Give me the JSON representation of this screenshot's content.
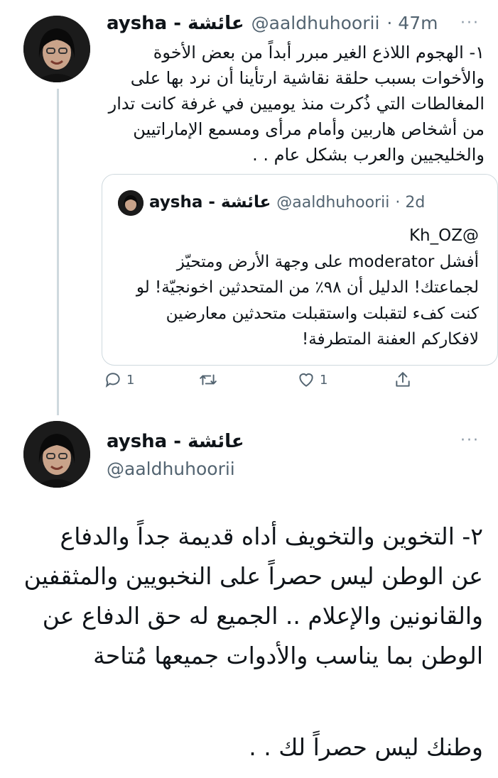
{
  "tweet1": {
    "display_name": "aysha - عائشة",
    "handle": "@aaldhuhoorii",
    "time": "· 47m",
    "more": "···",
    "text": "١- الهجوم اللاذع الغير مبرر أبداً من بعض الأخوة والأخوات بسبب حلقة نقاشية ارتأينا أن نرد بها على المغالطات التي ذُكرت منذ يوميين في غرفة كانت تدار من أشخاص هاربين وأمام مرأى ومسمع الإماراتيين والخليجيين والعرب بشكل عام . .",
    "quoted": {
      "display_name": "aysha - عائشة",
      "handle": "@aaldhuhoorii",
      "time": "· 2d",
      "mention": "@Kh_OZ",
      "text": "أفشل moderator على وجهة الأرض ومتحيّز لجماعتك! الدليل أن ٩٨٪ من المتحدثين اخونجيّة! لو كنت كفء لتقبلت واستقبلت متحدثين معارضين لافكاركم العفنة المتطرفة!"
    },
    "actions": {
      "reply_count": "1",
      "retweet_count": "",
      "like_count": "1"
    }
  },
  "tweet2": {
    "display_name": "aysha - عائشة",
    "handle": "@aaldhuhoorii",
    "more": "···",
    "text": "٢- التخوين والتخويف أداه قديمة جداً والدفاع عن الوطن ليس حصراً على النخبويين والمثقفين والقانونين والإعلام .. الجميع له حق الدفاع عن الوطن بما يناسب والأدوات جميعها مُتاحة",
    "text2": "وطنك ليس حصراً لك . ."
  },
  "icons": {
    "reply": "reply-icon",
    "retweet": "retweet-icon",
    "like": "heart-icon",
    "share": "share-icon",
    "more": "more-icon"
  }
}
